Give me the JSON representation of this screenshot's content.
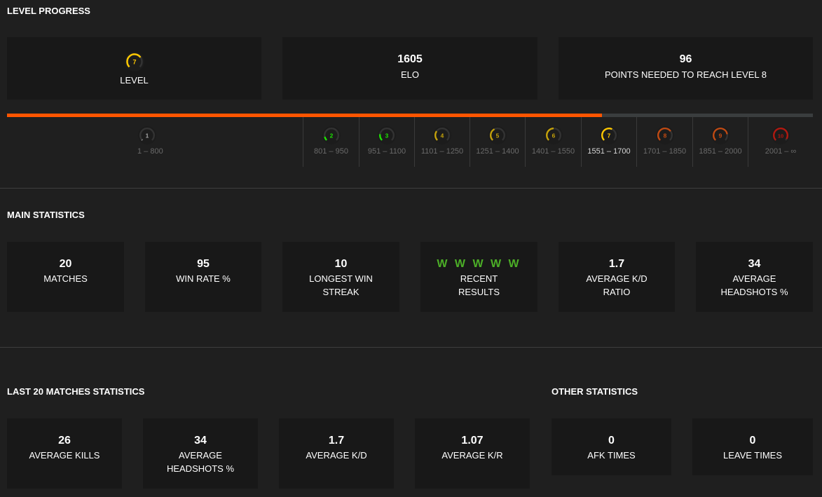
{
  "level_progress": {
    "title": "LEVEL PROGRESS",
    "level_card": {
      "level": "7",
      "label": "LEVEL",
      "gauge_fraction": 0.7,
      "color": "#ffc800"
    },
    "elo_card": {
      "value": "1605",
      "label": "ELO"
    },
    "points_card": {
      "value": "96",
      "label": "POINTS NEEDED TO REACH LEVEL 8"
    },
    "progress_fraction": 0.738,
    "progress_color": "#ff5500",
    "levels": [
      {
        "level": "1",
        "range": "1 – 800",
        "color": "#a6a6a6",
        "fraction": 0.02,
        "current": false
      },
      {
        "level": "2",
        "range": "801 – 950",
        "color": "#1ce400",
        "fraction": 0.12,
        "current": false
      },
      {
        "level": "3",
        "range": "951 – 1100",
        "color": "#1ce400",
        "fraction": 0.2,
        "current": false
      },
      {
        "level": "4",
        "range": "1101 – 1250",
        "color": "#c5a20a",
        "fraction": 0.3,
        "current": false
      },
      {
        "level": "5",
        "range": "1251 – 1400",
        "color": "#c5a20a",
        "fraction": 0.4,
        "current": false
      },
      {
        "level": "6",
        "range": "1401 – 1550",
        "color": "#c5a20a",
        "fraction": 0.5,
        "current": false
      },
      {
        "level": "7",
        "range": "1551 – 1700",
        "color": "#ffc800",
        "fraction": 0.6,
        "current": true
      },
      {
        "level": "8",
        "range": "1701 – 1850",
        "color": "#c24a12",
        "fraction": 0.7,
        "current": false
      },
      {
        "level": "9",
        "range": "1851 – 2000",
        "color": "#c24a12",
        "fraction": 0.8,
        "current": false
      },
      {
        "level": "10",
        "range": "2001 – ∞",
        "color": "#b3180f",
        "fraction": 0.95,
        "current": false
      }
    ]
  },
  "main_statistics": {
    "title": "MAIN STATISTICS",
    "cards": [
      {
        "value": "20",
        "label": "MATCHES"
      },
      {
        "value": "95",
        "label": "WIN RATE %"
      },
      {
        "value": "10",
        "label": "LONGEST WIN STREAK"
      },
      {
        "value": "W W W W W",
        "label": "RECENT RESULTS",
        "value_color": "#4caf27"
      },
      {
        "value": "1.7",
        "label": "AVERAGE K/D RATIO"
      },
      {
        "value": "34",
        "label": "AVERAGE HEADSHOTS %"
      }
    ]
  },
  "last_matches_statistics": {
    "title": "LAST 20 MATCHES STATISTICS",
    "cards": [
      {
        "value": "26",
        "label": "AVERAGE KILLS"
      },
      {
        "value": "34",
        "label": "AVERAGE HEADSHOTS %"
      },
      {
        "value": "1.7",
        "label": "AVERAGE K/D"
      },
      {
        "value": "1.07",
        "label": "AVERAGE K/R"
      }
    ]
  },
  "other_statistics": {
    "title": "OTHER STATISTICS",
    "cards": [
      {
        "value": "0",
        "label": "AFK TIMES"
      },
      {
        "value": "0",
        "label": "LEAVE TIMES"
      }
    ]
  }
}
